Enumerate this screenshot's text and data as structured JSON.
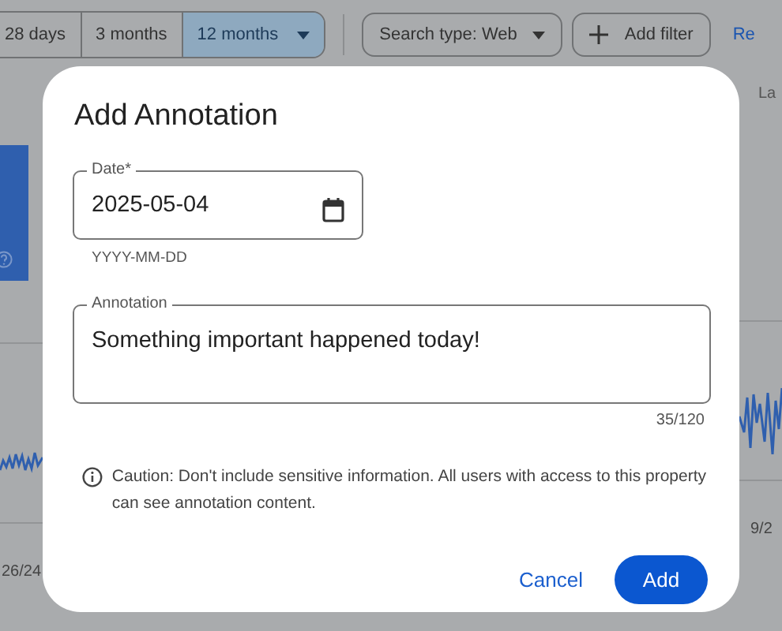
{
  "toolbar": {
    "ranges": [
      {
        "label": "28 days",
        "selected": false,
        "dropdown": false
      },
      {
        "label": "3 months",
        "selected": false,
        "dropdown": false
      },
      {
        "label": "12 months",
        "selected": true,
        "dropdown": true
      }
    ],
    "search_type": "Search type: Web",
    "add_filter": "Add filter",
    "link": "Re"
  },
  "background": {
    "right_label": "La",
    "left_date": "26/24",
    "right_date": "9/2"
  },
  "dialog": {
    "title": "Add Annotation",
    "date_field": {
      "label": "Date*",
      "value": "2025-05-04",
      "hint": "YYYY-MM-DD"
    },
    "annotation_field": {
      "label": "Annotation",
      "value": "Something important happened today!",
      "counter": "35/120"
    },
    "caution": "Caution: Don't include sensitive information. All users with access to this property can see annotation content.",
    "buttons": [
      {
        "label": "Cancel",
        "kind": "text"
      },
      {
        "label": "Add",
        "kind": "filled"
      }
    ]
  }
}
